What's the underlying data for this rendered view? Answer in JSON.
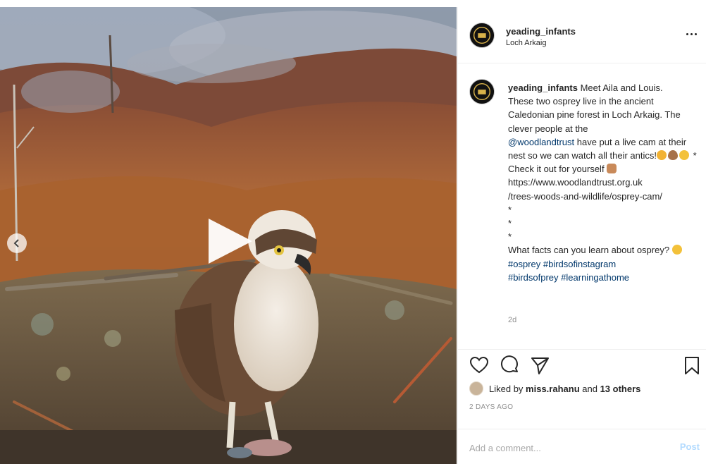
{
  "post": {
    "username": "yeading_infants",
    "location": "Loch Arkaig",
    "caption": {
      "username": "yeading_infants",
      "text_1": " Meet Aila and Louis.\nThese two osprey live in the ancient Caledonian pine forest in Loch Arkaig. The clever people at the\n",
      "mention": "@woodlandtrust",
      "text_2": " have put a live cam at their nest so we can watch all their antics!",
      "text_3": " *\nCheck it out for yourself ",
      "url": "\nhttps://www.woodlandtrust.org.uk\n/trees-woods-and-wildlife/osprey-cam/",
      "dots": "\n*\n*\n*\n",
      "question": "What facts can you learn about osprey? ",
      "tags": [
        "#osprey",
        "#birdsofinstagram",
        "#birdsofprey",
        "#learningathome"
      ]
    },
    "caption_age": "2d",
    "likes": {
      "prefix": "Liked by ",
      "user": "miss.rahanu",
      "and": " and ",
      "others": "13 others"
    },
    "time_ago": "2 DAYS AGO",
    "comment_placeholder": "Add a comment...",
    "post_label": "Post"
  },
  "icons": {
    "more": "more-options-icon",
    "like": "heart-icon",
    "comment": "comment-icon",
    "share": "paper-plane-icon",
    "save": "bookmark-icon",
    "prev": "chevron-left-icon",
    "play": "play-icon"
  },
  "colors": {
    "link": "#00376b",
    "muted": "#8e8e8e",
    "post_disabled": "#b3dbff"
  }
}
